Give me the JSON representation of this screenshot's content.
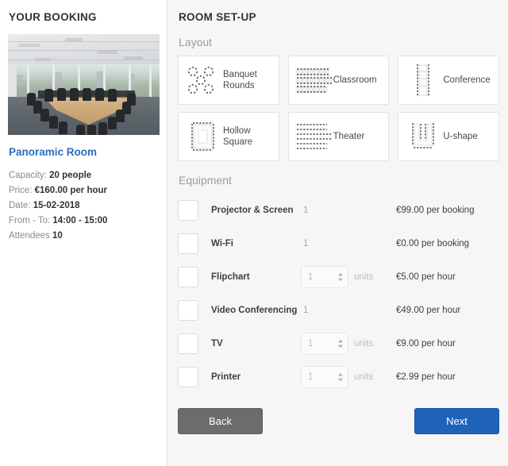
{
  "left": {
    "title": "YOUR BOOKING",
    "room_photo_alt": "meeting-room-photo",
    "room_name": "Panoramic Room",
    "details": [
      {
        "label": "Capacity:",
        "value": "20 people"
      },
      {
        "label": "Price:",
        "value": "€160.00 per hour"
      },
      {
        "label": "Date:",
        "value": "15-02-2018"
      },
      {
        "label": "From - To:",
        "value": "14:00 - 15:00"
      },
      {
        "label": "Attendees",
        "value": "10"
      }
    ]
  },
  "right": {
    "title": "ROOM SET-UP",
    "layout_label": "Layout",
    "equipment_label": "Equipment",
    "layouts": [
      {
        "id": "banquet-rounds",
        "label": "Banquet Rounds",
        "icon": "banquet-rounds-icon"
      },
      {
        "id": "classroom",
        "label": "Classroom",
        "icon": "classroom-icon"
      },
      {
        "id": "conference",
        "label": "Conference",
        "icon": "conference-icon"
      },
      {
        "id": "hollow-square",
        "label": "Hollow Square",
        "icon": "hollow-square-icon"
      },
      {
        "id": "theater",
        "label": "Theater",
        "icon": "theater-icon"
      },
      {
        "id": "u-shape",
        "label": "U-shape",
        "icon": "u-shape-icon"
      }
    ],
    "equipment": [
      {
        "id": "projector-screen",
        "name": "Projector & Screen",
        "checked": false,
        "qty_type": "text",
        "qty": "1",
        "units": "",
        "price": "€99.00 per booking"
      },
      {
        "id": "wifi",
        "name": "Wi-Fi",
        "checked": false,
        "qty_type": "text",
        "qty": "1",
        "units": "",
        "price": "€0.00 per booking"
      },
      {
        "id": "flipchart",
        "name": "Flipchart",
        "checked": false,
        "qty_type": "spinner",
        "qty": "1",
        "units": "units",
        "price": "€5.00 per hour"
      },
      {
        "id": "video-conferencing",
        "name": "Video Conferencing",
        "checked": false,
        "qty_type": "text",
        "qty": "1",
        "units": "",
        "price": "€49.00 per hour"
      },
      {
        "id": "tv",
        "name": "TV",
        "checked": false,
        "qty_type": "spinner",
        "qty": "1",
        "units": "units",
        "price": "€9.00 per hour"
      },
      {
        "id": "printer",
        "name": "Printer",
        "checked": false,
        "qty_type": "spinner",
        "qty": "1",
        "units": "units",
        "price": "€2.99 per hour"
      }
    ],
    "buttons": {
      "back": "Back",
      "next": "Next"
    }
  },
  "colors": {
    "link": "#2a6ebb",
    "next_button": "#1f62ba",
    "back_button": "#6c6c6c",
    "panel_background": "#f6f6f6",
    "card_background": "#ffffff"
  }
}
